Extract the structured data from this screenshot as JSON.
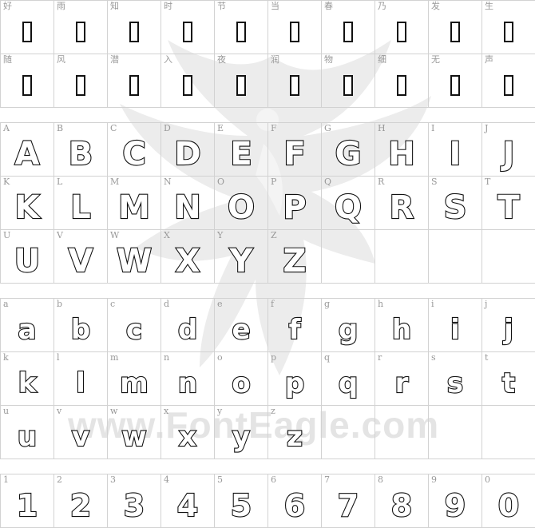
{
  "watermark": {
    "text": "www.FontEagle.com",
    "icon": "eagle-silhouette"
  },
  "rows": [
    {
      "group": "hanzi",
      "cells": [
        {
          "label": "好",
          "glyph": ""
        },
        {
          "label": "雨",
          "glyph": ""
        },
        {
          "label": "知",
          "glyph": ""
        },
        {
          "label": "时",
          "glyph": ""
        },
        {
          "label": "节",
          "glyph": ""
        },
        {
          "label": "当",
          "glyph": ""
        },
        {
          "label": "春",
          "glyph": ""
        },
        {
          "label": "乃",
          "glyph": ""
        },
        {
          "label": "发",
          "glyph": ""
        },
        {
          "label": "生",
          "glyph": ""
        }
      ]
    },
    {
      "group": "hanzi",
      "cells": [
        {
          "label": "随",
          "glyph": ""
        },
        {
          "label": "风",
          "glyph": ""
        },
        {
          "label": "潜",
          "glyph": ""
        },
        {
          "label": "入",
          "glyph": ""
        },
        {
          "label": "夜",
          "glyph": ""
        },
        {
          "label": "润",
          "glyph": ""
        },
        {
          "label": "物",
          "glyph": ""
        },
        {
          "label": "细",
          "glyph": ""
        },
        {
          "label": "无",
          "glyph": ""
        },
        {
          "label": "声",
          "glyph": ""
        }
      ]
    },
    {
      "group": "upper",
      "cells": [
        {
          "label": "A",
          "glyph": "A"
        },
        {
          "label": "B",
          "glyph": "B"
        },
        {
          "label": "C",
          "glyph": "C"
        },
        {
          "label": "D",
          "glyph": "D"
        },
        {
          "label": "E",
          "glyph": "E"
        },
        {
          "label": "F",
          "glyph": "F"
        },
        {
          "label": "G",
          "glyph": "G"
        },
        {
          "label": "H",
          "glyph": "H"
        },
        {
          "label": "I",
          "glyph": "I"
        },
        {
          "label": "J",
          "glyph": "J"
        }
      ]
    },
    {
      "group": "upper",
      "cells": [
        {
          "label": "K",
          "glyph": "K"
        },
        {
          "label": "L",
          "glyph": "L"
        },
        {
          "label": "M",
          "glyph": "M"
        },
        {
          "label": "N",
          "glyph": "N"
        },
        {
          "label": "O",
          "glyph": "O"
        },
        {
          "label": "P",
          "glyph": "P"
        },
        {
          "label": "Q",
          "glyph": "Q"
        },
        {
          "label": "R",
          "glyph": "R"
        },
        {
          "label": "S",
          "glyph": "S"
        },
        {
          "label": "T",
          "glyph": "T"
        }
      ]
    },
    {
      "group": "upper",
      "cells": [
        {
          "label": "U",
          "glyph": "U"
        },
        {
          "label": "V",
          "glyph": "V"
        },
        {
          "label": "W",
          "glyph": "W"
        },
        {
          "label": "X",
          "glyph": "X"
        },
        {
          "label": "Y",
          "glyph": "Y"
        },
        {
          "label": "Z",
          "glyph": "Z"
        },
        {
          "label": "",
          "glyph": ""
        },
        {
          "label": "",
          "glyph": ""
        },
        {
          "label": "",
          "glyph": ""
        },
        {
          "label": "",
          "glyph": ""
        }
      ]
    },
    {
      "group": "lower",
      "cells": [
        {
          "label": "a",
          "glyph": "a"
        },
        {
          "label": "b",
          "glyph": "b"
        },
        {
          "label": "c",
          "glyph": "c"
        },
        {
          "label": "d",
          "glyph": "d"
        },
        {
          "label": "e",
          "glyph": "e"
        },
        {
          "label": "f",
          "glyph": "f"
        },
        {
          "label": "g",
          "glyph": "g"
        },
        {
          "label": "h",
          "glyph": "h"
        },
        {
          "label": "i",
          "glyph": "i"
        },
        {
          "label": "j",
          "glyph": "j"
        }
      ]
    },
    {
      "group": "lower",
      "cells": [
        {
          "label": "k",
          "glyph": "k"
        },
        {
          "label": "l",
          "glyph": "l"
        },
        {
          "label": "m",
          "glyph": "m"
        },
        {
          "label": "n",
          "glyph": "n"
        },
        {
          "label": "o",
          "glyph": "o"
        },
        {
          "label": "p",
          "glyph": "p"
        },
        {
          "label": "q",
          "glyph": "q"
        },
        {
          "label": "r",
          "glyph": "r"
        },
        {
          "label": "s",
          "glyph": "s"
        },
        {
          "label": "t",
          "glyph": "t"
        }
      ]
    },
    {
      "group": "lower",
      "cells": [
        {
          "label": "u",
          "glyph": "u"
        },
        {
          "label": "v",
          "glyph": "v"
        },
        {
          "label": "w",
          "glyph": "w"
        },
        {
          "label": "x",
          "glyph": "x"
        },
        {
          "label": "y",
          "glyph": "y"
        },
        {
          "label": "z",
          "glyph": "z"
        },
        {
          "label": "",
          "glyph": ""
        },
        {
          "label": "",
          "glyph": ""
        },
        {
          "label": "",
          "glyph": ""
        },
        {
          "label": "",
          "glyph": ""
        }
      ]
    },
    {
      "group": "digit",
      "cells": [
        {
          "label": "1",
          "glyph": "1"
        },
        {
          "label": "2",
          "glyph": "2"
        },
        {
          "label": "3",
          "glyph": "3"
        },
        {
          "label": "4",
          "glyph": "4"
        },
        {
          "label": "5",
          "glyph": "5"
        },
        {
          "label": "6",
          "glyph": "6"
        },
        {
          "label": "7",
          "glyph": "7"
        },
        {
          "label": "8",
          "glyph": "8"
        },
        {
          "label": "9",
          "glyph": "9"
        },
        {
          "label": "0",
          "glyph": "0"
        }
      ]
    }
  ]
}
